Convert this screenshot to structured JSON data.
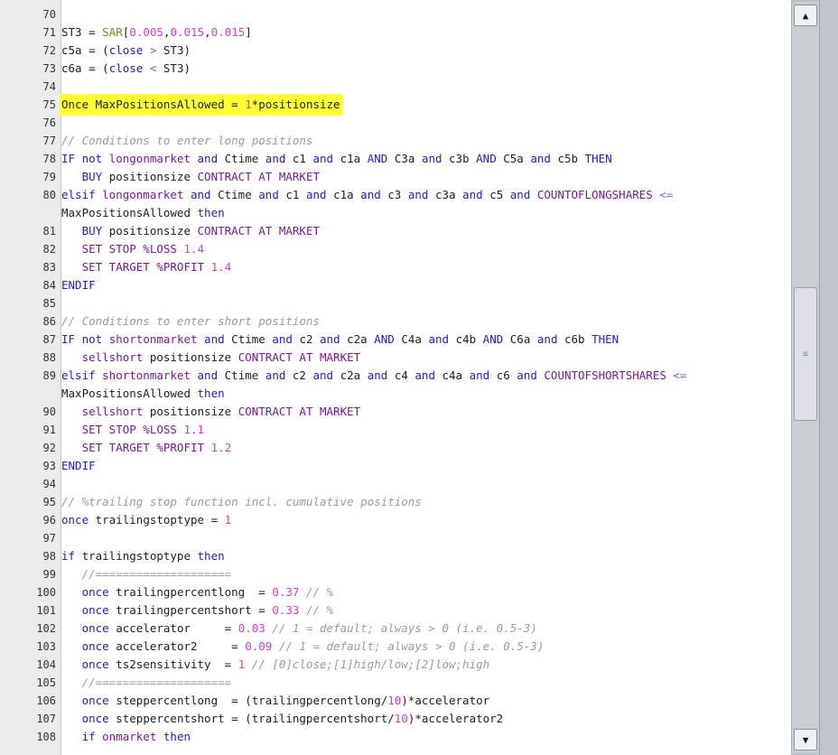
{
  "code_lines": [
    {
      "ln": "70",
      "t": []
    },
    {
      "ln": "71",
      "t": [
        [
          "",
          "ST3 = "
        ],
        [
          "fn",
          "SAR"
        ],
        [
          "",
          "["
        ],
        [
          "num",
          "0.005"
        ],
        [
          "",
          ","
        ],
        [
          "num",
          "0.015"
        ],
        [
          "",
          ","
        ],
        [
          "num",
          "0.015"
        ],
        [
          "",
          "]"
        ]
      ]
    },
    {
      "ln": "72",
      "t": [
        [
          "",
          "c5a = ("
        ],
        [
          "kw",
          "close"
        ],
        [
          "op",
          " > "
        ],
        [
          "",
          "ST3)"
        ]
      ]
    },
    {
      "ln": "73",
      "t": [
        [
          "",
          "c6a = ("
        ],
        [
          "kw",
          "close"
        ],
        [
          "op",
          " < "
        ],
        [
          "",
          "ST3)"
        ]
      ]
    },
    {
      "ln": "74",
      "t": []
    },
    {
      "ln": "75",
      "hl": true,
      "t": [
        [
          "",
          "Once MaxPositionsAllowed = "
        ],
        [
          "num",
          "1"
        ],
        [
          "",
          "*positionsize"
        ]
      ]
    },
    {
      "ln": "76",
      "t": []
    },
    {
      "ln": "77",
      "t": [
        [
          "cm",
          "// Conditions to enter long positions"
        ]
      ]
    },
    {
      "ln": "78",
      "t": [
        [
          "kw",
          "IF not "
        ],
        [
          "kw2",
          "longonmarket"
        ],
        [
          "kw",
          " and "
        ],
        [
          "",
          "Ctime "
        ],
        [
          "kw",
          "and "
        ],
        [
          "",
          "c1 "
        ],
        [
          "kw",
          "and "
        ],
        [
          "",
          "c1a "
        ],
        [
          "kw",
          "AND "
        ],
        [
          "",
          "C3a "
        ],
        [
          "kw",
          "and "
        ],
        [
          "",
          "c3b "
        ],
        [
          "kw",
          "AND "
        ],
        [
          "",
          "C5a "
        ],
        [
          "kw",
          "and "
        ],
        [
          "",
          "c5b "
        ],
        [
          "kw",
          "THEN"
        ]
      ]
    },
    {
      "ln": "79",
      "t": [
        [
          "",
          "   "
        ],
        [
          "kw",
          "BUY "
        ],
        [
          "",
          "positionsize "
        ],
        [
          "kw2",
          "CONTRACT AT MARKET"
        ]
      ]
    },
    {
      "ln": "80",
      "t": [
        [
          "kw",
          "elsif "
        ],
        [
          "kw2",
          "longonmarket"
        ],
        [
          "kw",
          " and "
        ],
        [
          "",
          "Ctime "
        ],
        [
          "kw",
          "and "
        ],
        [
          "",
          "c1 "
        ],
        [
          "kw",
          "and "
        ],
        [
          "",
          "c1a "
        ],
        [
          "kw",
          "and "
        ],
        [
          "",
          "c3 "
        ],
        [
          "kw",
          "and "
        ],
        [
          "",
          "c3a "
        ],
        [
          "kw",
          "and "
        ],
        [
          "",
          "c5 "
        ],
        [
          "kw",
          "and "
        ],
        [
          "kw2",
          "COUNTOFLONGSHARES"
        ],
        [
          "op",
          " <="
        ]
      ]
    },
    {
      "ln": "",
      "t": [
        [
          "",
          "MaxPositionsAllowed "
        ],
        [
          "kw",
          "then"
        ]
      ]
    },
    {
      "ln": "81",
      "t": [
        [
          "",
          "   "
        ],
        [
          "kw",
          "BUY "
        ],
        [
          "",
          "positionsize "
        ],
        [
          "kw2",
          "CONTRACT AT MARKET"
        ]
      ]
    },
    {
      "ln": "82",
      "t": [
        [
          "",
          "   "
        ],
        [
          "kw2",
          "SET STOP %LOSS "
        ],
        [
          "num",
          "1.4"
        ]
      ]
    },
    {
      "ln": "83",
      "t": [
        [
          "",
          "   "
        ],
        [
          "kw2",
          "SET TARGET %PROFIT "
        ],
        [
          "num",
          "1.4"
        ]
      ]
    },
    {
      "ln": "84",
      "t": [
        [
          "kw",
          "ENDIF"
        ]
      ]
    },
    {
      "ln": "85",
      "t": []
    },
    {
      "ln": "86",
      "t": [
        [
          "cm",
          "// Conditions to enter short positions"
        ]
      ]
    },
    {
      "ln": "87",
      "t": [
        [
          "kw",
          "IF not "
        ],
        [
          "kw2",
          "shortonmarket"
        ],
        [
          "kw",
          " and "
        ],
        [
          "",
          "Ctime "
        ],
        [
          "kw",
          "and "
        ],
        [
          "",
          "c2 "
        ],
        [
          "kw",
          "and "
        ],
        [
          "",
          "c2a "
        ],
        [
          "kw",
          "AND "
        ],
        [
          "",
          "C4a "
        ],
        [
          "kw",
          "and "
        ],
        [
          "",
          "c4b "
        ],
        [
          "kw",
          "AND "
        ],
        [
          "",
          "C6a "
        ],
        [
          "kw",
          "and "
        ],
        [
          "",
          "c6b "
        ],
        [
          "kw",
          "THEN"
        ]
      ]
    },
    {
      "ln": "88",
      "t": [
        [
          "",
          "   "
        ],
        [
          "kw2",
          "sellshort "
        ],
        [
          "",
          "positionsize "
        ],
        [
          "kw2",
          "CONTRACT AT MARKET"
        ]
      ]
    },
    {
      "ln": "89",
      "t": [
        [
          "kw",
          "elsif "
        ],
        [
          "kw2",
          "shortonmarket"
        ],
        [
          "kw",
          " and "
        ],
        [
          "",
          "Ctime "
        ],
        [
          "kw",
          "and "
        ],
        [
          "",
          "c2 "
        ],
        [
          "kw",
          "and "
        ],
        [
          "",
          "c2a "
        ],
        [
          "kw",
          "and "
        ],
        [
          "",
          "c4 "
        ],
        [
          "kw",
          "and "
        ],
        [
          "",
          "c4a "
        ],
        [
          "kw",
          "and "
        ],
        [
          "",
          "c6 "
        ],
        [
          "kw",
          "and "
        ],
        [
          "kw2",
          "COUNTOFSHORTSHARES"
        ],
        [
          "op",
          " <="
        ]
      ]
    },
    {
      "ln": "",
      "t": [
        [
          "",
          "MaxPositionsAllowed "
        ],
        [
          "kw",
          "then"
        ]
      ]
    },
    {
      "ln": "90",
      "t": [
        [
          "",
          "   "
        ],
        [
          "kw2",
          "sellshort "
        ],
        [
          "",
          "positionsize "
        ],
        [
          "kw2",
          "CONTRACT AT MARKET"
        ]
      ]
    },
    {
      "ln": "91",
      "t": [
        [
          "",
          "   "
        ],
        [
          "kw2",
          "SET STOP %LOSS "
        ],
        [
          "num",
          "1.1"
        ]
      ]
    },
    {
      "ln": "92",
      "t": [
        [
          "",
          "   "
        ],
        [
          "kw2",
          "SET TARGET %PROFIT "
        ],
        [
          "num",
          "1.2"
        ]
      ]
    },
    {
      "ln": "93",
      "t": [
        [
          "kw",
          "ENDIF"
        ]
      ]
    },
    {
      "ln": "94",
      "t": []
    },
    {
      "ln": "95",
      "t": [
        [
          "cm",
          "// %trailing stop function incl. cumulative positions"
        ]
      ]
    },
    {
      "ln": "96",
      "t": [
        [
          "kw",
          "once "
        ],
        [
          "",
          "trailingstoptype = "
        ],
        [
          "num",
          "1"
        ]
      ]
    },
    {
      "ln": "97",
      "t": []
    },
    {
      "ln": "98",
      "t": [
        [
          "kw",
          "if "
        ],
        [
          "",
          "trailingstoptype "
        ],
        [
          "kw",
          "then"
        ]
      ]
    },
    {
      "ln": "99",
      "t": [
        [
          "",
          "   "
        ],
        [
          "cm",
          "//===================="
        ]
      ]
    },
    {
      "ln": "100",
      "t": [
        [
          "",
          "   "
        ],
        [
          "kw",
          "once "
        ],
        [
          "",
          "trailingpercentlong  = "
        ],
        [
          "num",
          "0.37"
        ],
        [
          "cm",
          " // %"
        ]
      ]
    },
    {
      "ln": "101",
      "t": [
        [
          "",
          "   "
        ],
        [
          "kw",
          "once "
        ],
        [
          "",
          "trailingpercentshort = "
        ],
        [
          "num",
          "0.33"
        ],
        [
          "cm",
          " // %"
        ]
      ]
    },
    {
      "ln": "102",
      "t": [
        [
          "",
          "   "
        ],
        [
          "kw",
          "once "
        ],
        [
          "",
          "accelerator     = "
        ],
        [
          "num",
          "0.03"
        ],
        [
          "cm",
          " // 1 = default; always > 0 (i.e. 0.5-3)"
        ]
      ]
    },
    {
      "ln": "103",
      "t": [
        [
          "",
          "   "
        ],
        [
          "kw",
          "once "
        ],
        [
          "",
          "accelerator2     = "
        ],
        [
          "num",
          "0.09"
        ],
        [
          "cm",
          " // 1 = default; always > 0 (i.e. 0.5-3)"
        ]
      ]
    },
    {
      "ln": "104",
      "t": [
        [
          "",
          "   "
        ],
        [
          "kw",
          "once "
        ],
        [
          "",
          "ts2sensitivity  = "
        ],
        [
          "num",
          "1"
        ],
        [
          "cm",
          " // [0]close;[1]high/low;[2]low;high"
        ]
      ]
    },
    {
      "ln": "105",
      "t": [
        [
          "",
          "   "
        ],
        [
          "cm",
          "//===================="
        ]
      ]
    },
    {
      "ln": "106",
      "t": [
        [
          "",
          "   "
        ],
        [
          "kw",
          "once "
        ],
        [
          "",
          "steppercentlong  = (trailingpercentlong/"
        ],
        [
          "num",
          "10"
        ],
        [
          "",
          ")*accelerator"
        ]
      ]
    },
    {
      "ln": "107",
      "t": [
        [
          "",
          "   "
        ],
        [
          "kw",
          "once "
        ],
        [
          "",
          "steppercentshort = (trailingpercentshort/"
        ],
        [
          "num",
          "10"
        ],
        [
          "",
          ")*accelerator2"
        ]
      ]
    },
    {
      "ln": "108",
      "t": [
        [
          "",
          "   "
        ],
        [
          "kw",
          "if "
        ],
        [
          "kw2",
          "onmarket "
        ],
        [
          "kw",
          "then"
        ]
      ]
    }
  ],
  "scrollbar": {
    "up_icon": "▲",
    "down_icon": "▼",
    "thumb_grip": "≡"
  }
}
